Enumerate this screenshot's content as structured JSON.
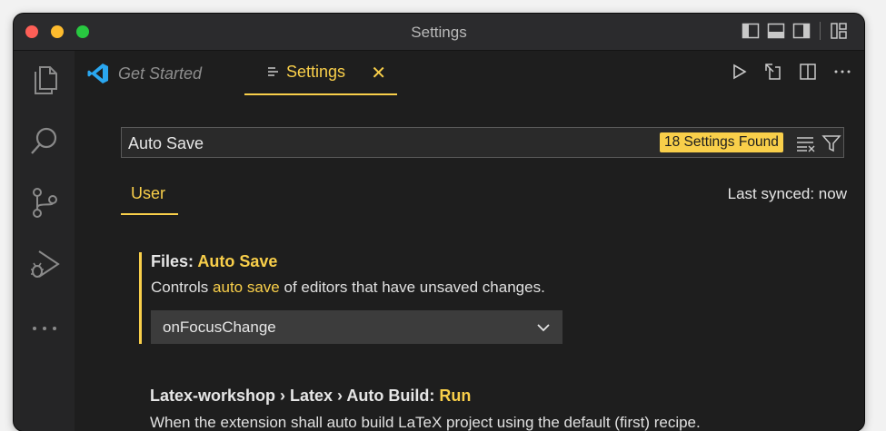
{
  "window": {
    "title": "Settings"
  },
  "tabs": {
    "get_started": {
      "label": "Get Started"
    },
    "settings": {
      "label": "Settings"
    }
  },
  "search": {
    "value": "Auto Save",
    "results_badge": "18 Settings Found"
  },
  "scope": {
    "user_tab": "User",
    "last_synced": "Last synced: now"
  },
  "settings": [
    {
      "category": "Files: ",
      "name": "Auto Save",
      "description_prefix": "Controls ",
      "description_highlight": "auto save",
      "description_suffix": " of editors that have unsaved changes.",
      "selected_value": "onFocusChange"
    },
    {
      "category": "Latex-workshop › Latex › Auto Build: ",
      "name": "Run",
      "description": "When the extension shall auto build LaTeX project using the default (first) recipe."
    }
  ],
  "colors": {
    "accent": "#f9cf4a",
    "background": "#1e1e1e",
    "vscode_blue": "#2aa7f0"
  }
}
